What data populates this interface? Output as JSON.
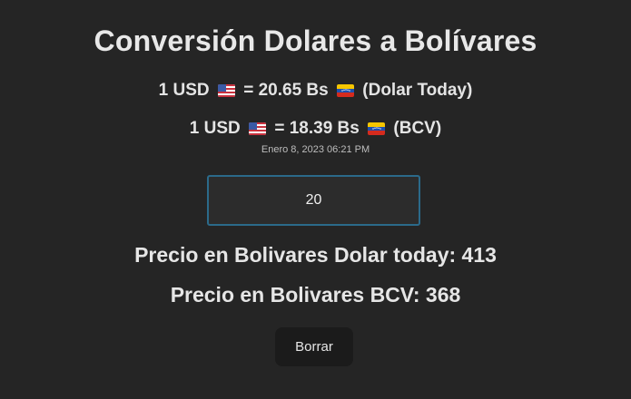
{
  "title": "Conversión Dolares a Bolívares",
  "rates": [
    {
      "usd_label": "1 USD",
      "equals": "=",
      "value": "20.65 Bs",
      "source": "(Dolar Today)"
    },
    {
      "usd_label": "1 USD",
      "equals": "=",
      "value": "18.39 Bs",
      "source": "(BCV)"
    }
  ],
  "timestamp": "Enero 8, 2023 06:21 PM",
  "amount_input": {
    "value": "20"
  },
  "results": {
    "dolar_today_label": "Precio en Bolivares Dolar today:",
    "dolar_today_value": "413",
    "bcv_label": "Precio en Bolivares BCV:",
    "bcv_value": "368"
  },
  "clear_button_label": "Borrar",
  "icons": {
    "usd_flag": "us-flag-icon",
    "bs_flag": "venezuela-flag-icon"
  },
  "colors": {
    "background": "#252525",
    "input_border": "#2b6a8a",
    "button_background": "#1b1b1b"
  }
}
